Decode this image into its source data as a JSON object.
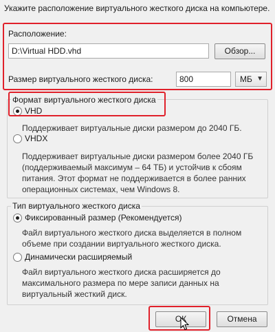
{
  "header": {
    "instruction": "Укажите расположение виртуального жесткого диска на компьютере."
  },
  "location": {
    "label": "Расположение:",
    "path_value": "D:\\Virtual HDD.vhd",
    "browse_label": "Обзор...",
    "size_label": "Размер виртуального жесткого диска:",
    "size_value": "800",
    "unit_selected": "МБ"
  },
  "format": {
    "legend": "Формат виртуального жесткого диска",
    "options": [
      {
        "label": "VHD",
        "selected": true,
        "description": "Поддерживает виртуальные диски размером до 2040 ГБ."
      },
      {
        "label": "VHDX",
        "selected": false,
        "description": "Поддерживает виртуальные диски размером более 2040 ГБ (поддерживаемый максимум – 64 ТБ) и устойчив к сбоям питания. Этот формат не поддерживается в более ранних операционных системах, чем Windows 8."
      }
    ]
  },
  "disk_type": {
    "legend": "Тип виртуального жесткого диска",
    "options": [
      {
        "label": "Фиксированный размер (Рекомендуется)",
        "selected": true,
        "description": "Файл виртуального жесткого диска выделяется в полном объеме при создании виртуального жесткого диска."
      },
      {
        "label": "Динамически расширяемый",
        "selected": false,
        "description": "Файл виртуального жесткого диска расширяется до максимального размера по мере записи данных на виртуальный жесткий диск."
      }
    ]
  },
  "footer": {
    "ok_label": "ОК",
    "cancel_label": "Отмена"
  },
  "colors": {
    "highlight": "#e0202a",
    "background": "#f0f0f0"
  }
}
